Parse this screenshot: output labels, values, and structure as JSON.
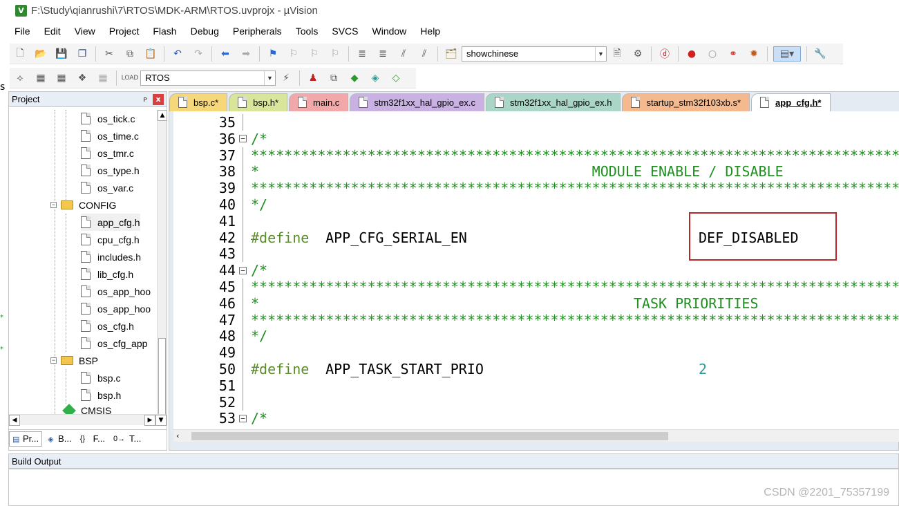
{
  "window": {
    "title": "F:\\Study\\qianrushi\\7\\RTOS\\MDK-ARM\\RTOS.uvprojx - µVision",
    "app_icon_letter": "V"
  },
  "menu": [
    "File",
    "Edit",
    "View",
    "Project",
    "Flash",
    "Debug",
    "Peripherals",
    "Tools",
    "SVCS",
    "Window",
    "Help"
  ],
  "toolbar": {
    "find_combo_value": "showchinese",
    "target_combo_value": "RTOS"
  },
  "edge": {
    "letter": "s"
  },
  "project_panel": {
    "title": "Project",
    "pin_glyph": "ᴘ",
    "close_glyph": "x",
    "tree": [
      {
        "label": "os_tick.c",
        "type": "file"
      },
      {
        "label": "os_time.c",
        "type": "file"
      },
      {
        "label": "os_tmr.c",
        "type": "file"
      },
      {
        "label": "os_type.h",
        "type": "file"
      },
      {
        "label": "os_var.c",
        "type": "file"
      },
      {
        "label": "CONFIG",
        "type": "folder"
      },
      {
        "label": "app_cfg.h",
        "type": "file"
      },
      {
        "label": "cpu_cfg.h",
        "type": "file"
      },
      {
        "label": "includes.h",
        "type": "file"
      },
      {
        "label": "lib_cfg.h",
        "type": "file"
      },
      {
        "label": "os_app_hoo",
        "type": "file"
      },
      {
        "label": "os_app_hoo",
        "type": "file"
      },
      {
        "label": "os_cfg.h",
        "type": "file"
      },
      {
        "label": "os_cfg_app",
        "type": "file"
      },
      {
        "label": "BSP",
        "type": "folder"
      },
      {
        "label": "bsp.c",
        "type": "file"
      },
      {
        "label": "bsp.h",
        "type": "file"
      },
      {
        "label": "CMSIS",
        "type": "group"
      }
    ],
    "tabs": [
      {
        "label": "Pr...",
        "icon": "▤"
      },
      {
        "label": "B...",
        "icon": "◈"
      },
      {
        "label": "F...",
        "icon": "{}"
      },
      {
        "label": "T...",
        "icon": "0→"
      }
    ]
  },
  "editor": {
    "tabs": [
      {
        "label": "bsp.c*",
        "color": "#f6d77a"
      },
      {
        "label": "bsp.h*",
        "color": "#d9e59a"
      },
      {
        "label": "main.c",
        "color": "#f2a8a8"
      },
      {
        "label": "stm32f1xx_hal_gpio_ex.c",
        "color": "#c9b2e3"
      },
      {
        "label": "stm32f1xx_hal_gpio_ex.h",
        "color": "#a9d6c6"
      },
      {
        "label": "startup_stm32f103xb.s*",
        "color": "#f4b98e"
      },
      {
        "label": "app_cfg.h*",
        "color": "#ffffff"
      }
    ],
    "lines": [
      {
        "n": "35",
        "text": ""
      },
      {
        "n": "36",
        "text": "/*",
        "fold": true
      },
      {
        "n": "37",
        "text": "**********************************************************************************************************"
      },
      {
        "n": "38",
        "text": "*                                        MODULE ENABLE / DISABLE"
      },
      {
        "n": "39",
        "text": "**********************************************************************************************************"
      },
      {
        "n": "40",
        "text": "*/"
      },
      {
        "n": "41",
        "text": ""
      },
      {
        "n": "42",
        "define": "#define",
        "name": "  APP_CFG_SERIAL_EN",
        "value": "DEF_DISABLED"
      },
      {
        "n": "43",
        "text": ""
      },
      {
        "n": "44",
        "text": "/*",
        "fold": true
      },
      {
        "n": "45",
        "text": "**********************************************************************************************************"
      },
      {
        "n": "46",
        "text": "*                                             TASK PRIORITIES"
      },
      {
        "n": "47",
        "text": "**********************************************************************************************************"
      },
      {
        "n": "48",
        "text": "*/"
      },
      {
        "n": "49",
        "text": ""
      },
      {
        "n": "50",
        "define": "#define",
        "name": "  APP_TASK_START_PRIO",
        "value": "2"
      },
      {
        "n": "51",
        "text": ""
      },
      {
        "n": "52",
        "text": ""
      },
      {
        "n": "53",
        "text": "/*",
        "fold": true
      }
    ]
  },
  "build_output": {
    "title": "Build Output"
  },
  "watermark": "CSDN @2201_75357199",
  "colors": {
    "comment": "#1f8f1f",
    "number": "#2a9a9a",
    "highlight": "#b8262a"
  }
}
